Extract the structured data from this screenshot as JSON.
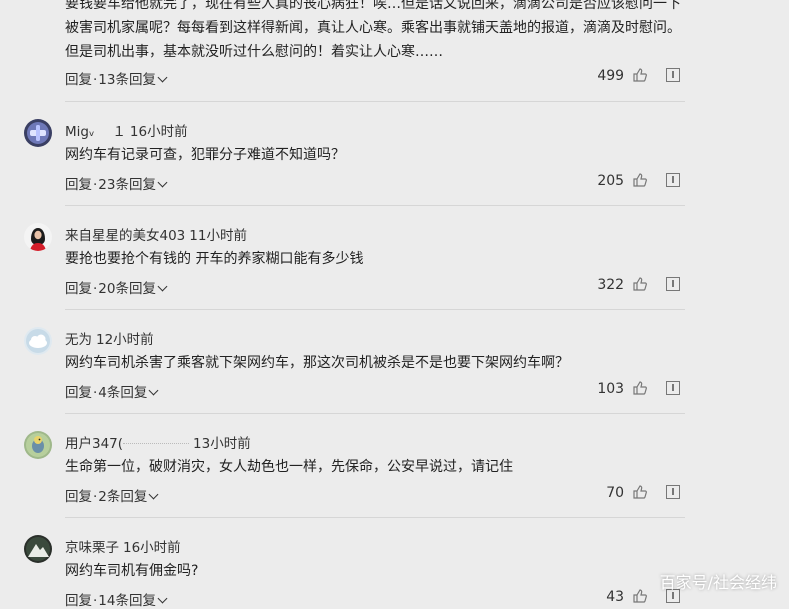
{
  "top_comment": {
    "lines": [
      "要钱要车给他就完了，现在有些人真的丧心病狂！唉…但是话又说回来，滴滴公司是否应该慰问一下",
      "被害司机家属呢？每每看到这样得新闻，真让人心寒。乘客出事就铺天盖地的报道，滴滴及时慰问。",
      "但是司机出事，基本就没听过什么慰问的！着实让人心寒……"
    ],
    "reply_label": "回复",
    "replies_label": "13条回复",
    "likes": "499"
  },
  "comments": [
    {
      "user": "Migᵥ 　１",
      "time": "16小时前",
      "text": "网约车有记录可查，犯罪分子难道不知道吗？",
      "reply_label": "回复",
      "replies_label": "23条回复",
      "likes": "205",
      "avatar": "game-avatar"
    },
    {
      "user": "来自星星的美女403",
      "time": "11小时前",
      "text": "要抢也要抢个有钱的 开车的养家糊口能有多少钱",
      "reply_label": "回复",
      "replies_label": "20条回复",
      "likes": "322",
      "avatar": "woman-avatar"
    },
    {
      "user": "无为",
      "time": "12小时前",
      "text": "网约车司机杀害了乘客就下架网约车，那这次司机被杀是不是也要下架网约车啊？",
      "reply_label": "回复",
      "replies_label": "4条回复",
      "likes": "103",
      "avatar": "cloud-avatar"
    },
    {
      "user": "用户347(",
      "time": "13小时前",
      "text": "生命第一位，破财消灾，女人劫色也一样，先保命，公安早说过，请记住",
      "reply_label": "回复",
      "replies_label": "2条回复",
      "likes": "70",
      "avatar": "bird-avatar"
    },
    {
      "user": "京味栗子",
      "time": "16小时前",
      "text": "网约车司机有佣金吗?",
      "reply_label": "回复",
      "replies_label": "14条回复",
      "likes": "43",
      "avatar": "mountain-avatar"
    }
  ],
  "watermark": "百家号/社会经纬",
  "colors": {
    "background": "#ececec",
    "text": "#222222",
    "divider": "#d6d6d6",
    "icon": "#777777"
  }
}
